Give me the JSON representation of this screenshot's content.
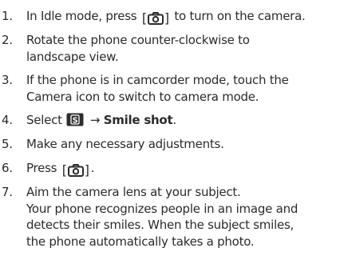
{
  "steps": [
    {
      "number": "1.",
      "before": "In Idle mode, press",
      "key_icon": "camera-key-icon",
      "after": "to turn on the camera."
    },
    {
      "number": "2.",
      "line1": "Rotate the phone counter-clockwise to",
      "line2": "landscape view."
    },
    {
      "number": "3.",
      "line1": "If the phone is in camcorder mode, touch the",
      "line2": "Camera icon to switch to camera mode."
    },
    {
      "number": "4.",
      "before": "Select",
      "menu_icon": "shooting-mode-icon",
      "menu_icon_letter": "S",
      "arrow": "→",
      "bold": "Smile shot",
      "after": "."
    },
    {
      "number": "5.",
      "line1": "Make any necessary adjustments."
    },
    {
      "number": "6.",
      "before": "Press",
      "key_icon": "camera-key-icon",
      "after": "."
    },
    {
      "number": "7.",
      "line1": "Aim the camera lens at your subject.",
      "line2": "Your phone recognizes people in an image and",
      "line3": "detects their smiles. When the subject smiles,",
      "line4": "the phone automatically takes a photo."
    }
  ],
  "brackets": {
    "open": "[",
    "close": "]"
  },
  "colors": {
    "text": "#2b2b2b",
    "icon_bg": "#2e2e2e",
    "icon_fg": "#ffffff"
  }
}
